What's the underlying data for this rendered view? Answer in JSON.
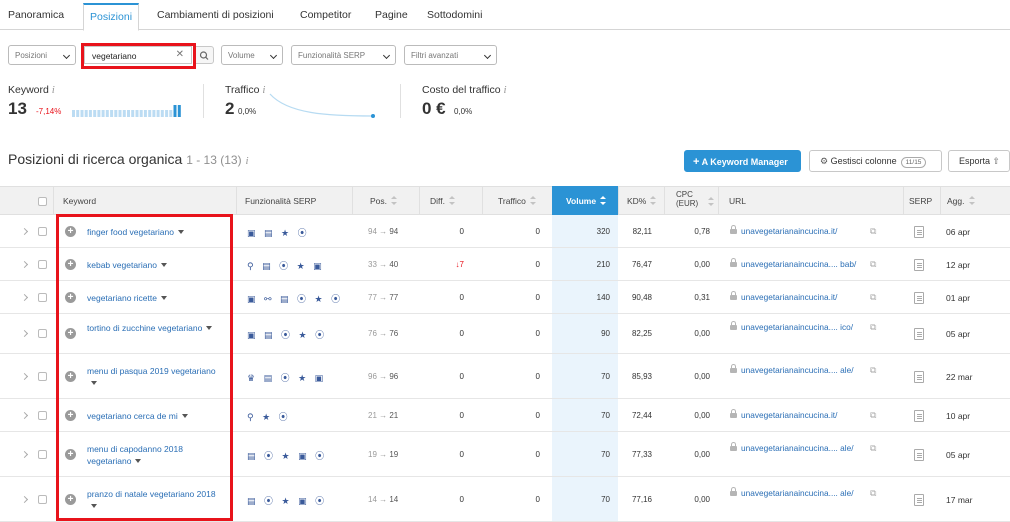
{
  "tabs": [
    "Panoramica",
    "Posizioni",
    "Cambiamenti di posizioni",
    "Competitor",
    "Pagine",
    "Sottodomini"
  ],
  "filters": {
    "positions": "Posizioni",
    "search_value": "vegetariano",
    "volume": "Volume",
    "serp": "Funzionalità SERP",
    "advanced": "Filtri avanzati"
  },
  "metrics": {
    "keyword": {
      "label": "Keyword",
      "value": "13",
      "delta": "-7,14%",
      "bars": [
        0.55,
        0.55,
        0.55,
        0.55,
        0.55,
        0.55,
        0.55,
        0.55,
        0.55,
        0.55,
        0.55,
        0.55,
        0.55,
        0.55,
        0.55,
        0.55,
        0.55,
        0.55,
        0.55,
        0.55,
        0.55,
        0.55,
        0.55,
        0.55,
        1,
        1
      ]
    },
    "traffic": {
      "label": "Traffico",
      "value": "2",
      "delta": "0,0%"
    },
    "cost": {
      "label": "Costo del traffico",
      "value": "0 €",
      "delta": "0,0%"
    }
  },
  "section": {
    "title": "Posizioni di ricerca organica",
    "range": "1 - 13 (13)"
  },
  "buttons": {
    "keyword_manager": "A Keyword Manager",
    "columns": "Gestisci colonne",
    "columns_badge": "11/15",
    "export": "Esporta"
  },
  "columns": {
    "keyword": "Keyword",
    "serp": "Funzionalità SERP",
    "pos": "Pos.",
    "diff": "Diff.",
    "traffic": "Traffico",
    "volume": "Volume",
    "kd": "KD%",
    "cpc": "CPC (EUR)",
    "url": "URL",
    "serp_short": "SERP",
    "agg": "Agg."
  },
  "rows": [
    {
      "keyword": "finger food vegetariano",
      "serp": "▣ ▤ ★ ⦿",
      "pos_from": "94",
      "pos_to": "94",
      "diff": "0",
      "traffic": "0",
      "volume": "320",
      "kd": "82,11",
      "cpc": "0,78",
      "url": "unavegetarianaincucina.it/",
      "date": "06 apr"
    },
    {
      "keyword": "kebab vegetariano",
      "serp": "⚲ ▤ ⦿ ★ ▣",
      "pos_from": "33",
      "pos_to": "40",
      "diff": "↓7",
      "traffic": "0",
      "volume": "210",
      "kd": "76,47",
      "cpc": "0,00",
      "url": "unavegetarianaincucina.... bab/",
      "date": "12 apr"
    },
    {
      "keyword": "vegetariano ricette",
      "serp": "▣ ⚯ ▤ ⦿ ★ ⦿",
      "pos_from": "77",
      "pos_to": "77",
      "diff": "0",
      "traffic": "0",
      "volume": "140",
      "kd": "90,48",
      "cpc": "0,31",
      "url": "unavegetarianaincucina.it/",
      "date": "01 apr"
    },
    {
      "keyword": "tortino di zucchine vegetariano",
      "serp": "▣ ▤ ⦿ ★ ⦿",
      "pos_from": "76",
      "pos_to": "76",
      "diff": "0",
      "traffic": "0",
      "volume": "90",
      "kd": "82,25",
      "cpc": "0,00",
      "url": "unavegetarianaincucina.... ico/",
      "date": "05 apr"
    },
    {
      "keyword": "menu di pasqua 2019 vegetariano",
      "serp": "♛ ▤ ⦿ ★ ▣",
      "pos_from": "96",
      "pos_to": "96",
      "diff": "0",
      "traffic": "0",
      "volume": "70",
      "kd": "85,93",
      "cpc": "0,00",
      "url": "unavegetarianaincucina.... ale/",
      "date": "22 mar"
    },
    {
      "keyword": "vegetariano cerca de mi",
      "serp": "⚲ ★ ⦿",
      "pos_from": "21",
      "pos_to": "21",
      "diff": "0",
      "traffic": "0",
      "volume": "70",
      "kd": "72,44",
      "cpc": "0,00",
      "url": "unavegetarianaincucina.it/",
      "date": "10 apr"
    },
    {
      "keyword": "menu di capodanno 2018 vegetariano",
      "serp": "▤ ⦿ ★ ▣ ⦿",
      "pos_from": "19",
      "pos_to": "19",
      "diff": "0",
      "traffic": "0",
      "volume": "70",
      "kd": "77,33",
      "cpc": "0,00",
      "url": "unavegetarianaincucina.... ale/",
      "date": "05 apr"
    },
    {
      "keyword": "pranzo di natale vegetariano 2018",
      "serp": "▤ ⦿ ★ ▣ ⦿",
      "pos_from": "14",
      "pos_to": "14",
      "diff": "0",
      "traffic": "0",
      "volume": "70",
      "kd": "77,16",
      "cpc": "0,00",
      "url": "unavegetarianaincucina.... ale/",
      "date": "17 mar"
    }
  ],
  "colors": {
    "accent": "#2b93d5",
    "highlight": "#e8131b",
    "negative": "#e8131b"
  }
}
